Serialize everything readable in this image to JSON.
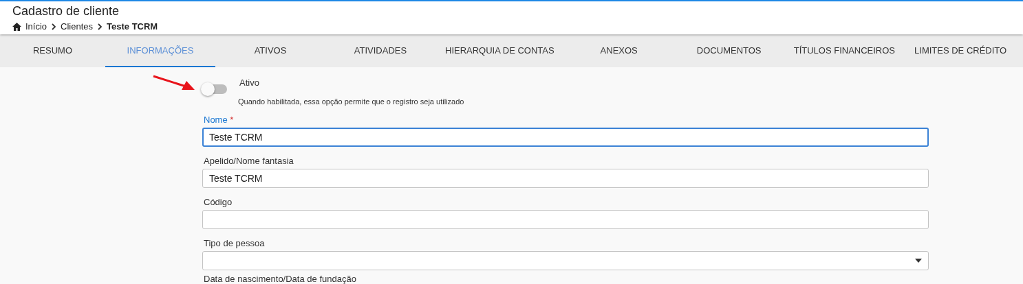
{
  "header": {
    "title": "Cadastro de cliente",
    "breadcrumb": [
      {
        "label": "Início",
        "kind": "home"
      },
      {
        "label": "Clientes",
        "kind": "link"
      },
      {
        "label": "Teste TCRM",
        "kind": "current"
      }
    ]
  },
  "tabs": [
    {
      "label": "RESUMO",
      "selected": false
    },
    {
      "label": "INFORMAÇÕES",
      "selected": true
    },
    {
      "label": "ATIVOS",
      "selected": false
    },
    {
      "label": "ATIVIDADES",
      "selected": false
    },
    {
      "label": "HIERARQUIA DE CONTAS",
      "selected": false
    },
    {
      "label": "ANEXOS",
      "selected": false
    },
    {
      "label": "DOCUMENTOS",
      "selected": false
    },
    {
      "label": "TÍTULOS FINANCEIROS",
      "selected": false
    },
    {
      "label": "LIMITES DE CRÉDITO",
      "selected": false
    }
  ],
  "form": {
    "toggle": {
      "label": "Ativo",
      "help": "Quando habilitada, essa opção permite que o registro seja utilizado",
      "on": false
    },
    "fields": [
      {
        "label": "Nome",
        "required_mark": "*",
        "kind": "text",
        "value": "Teste TCRM",
        "focused": true
      },
      {
        "label": "Apelido/Nome fantasia",
        "kind": "text",
        "value": "Teste TCRM",
        "focused": false
      },
      {
        "label": "Código",
        "kind": "text",
        "focused": false
      },
      {
        "label": "Tipo de pessoa",
        "kind": "select",
        "focused": false
      },
      {
        "label": "Data de nascimento/Data de fundação",
        "kind": "label"
      }
    ]
  }
}
